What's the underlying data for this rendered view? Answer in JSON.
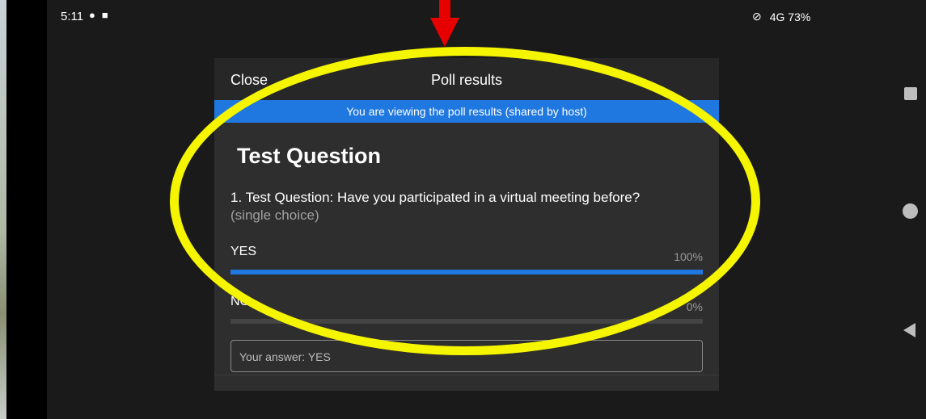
{
  "status_bar": {
    "time": "5:11",
    "right_text": "4G 73%"
  },
  "dialog": {
    "close_label": "Close",
    "title": "Poll results",
    "banner": "You are viewing the poll results (shared by host)",
    "heading": "Test Question",
    "question": "1. Test Question: Have you participated in a virtual meeting before?",
    "question_type": "(single choice)",
    "options": [
      {
        "label": "YES",
        "percent_text": "100%",
        "fill": 1.0
      },
      {
        "label": "NO",
        "percent_text": "0%",
        "fill": 0.0
      }
    ],
    "your_answer": "Your answer: YES"
  },
  "colors": {
    "accent": "#1f77e0",
    "highlight": "#f5f500",
    "arrow": "#e60000"
  }
}
